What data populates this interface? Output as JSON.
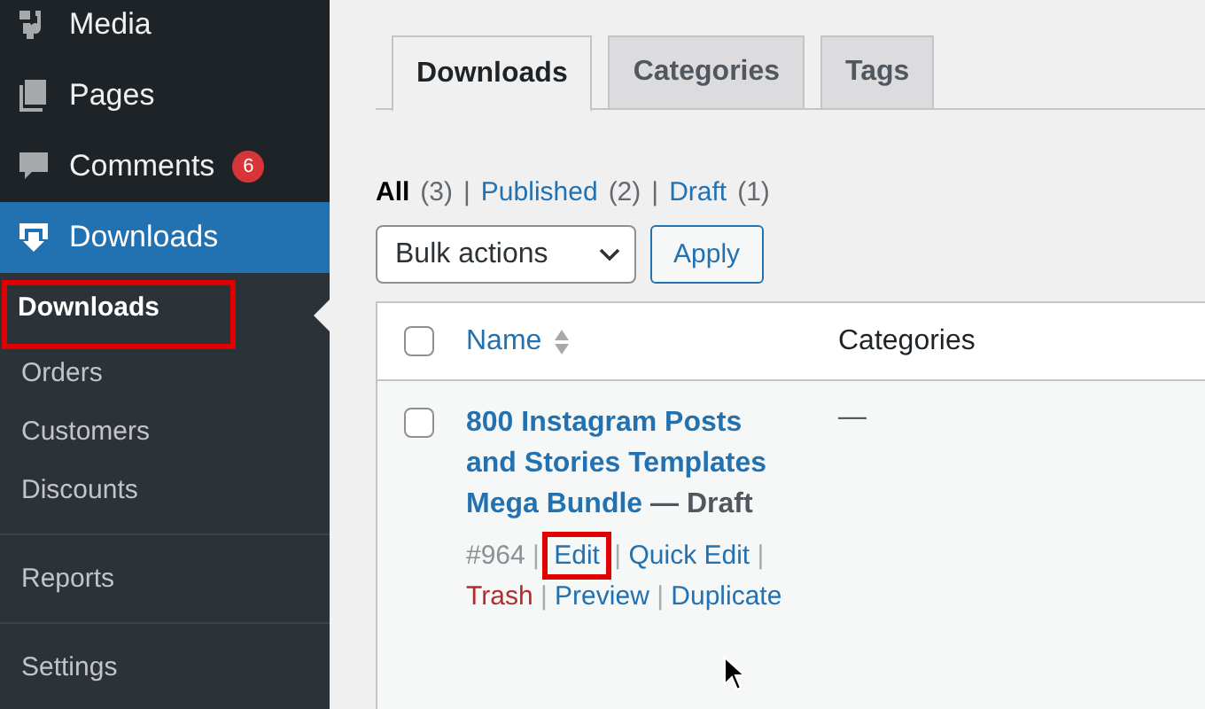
{
  "sidebar": {
    "menu": [
      {
        "kind": "media",
        "label": "Media",
        "current": false
      },
      {
        "kind": "pages",
        "label": "Pages",
        "current": false
      },
      {
        "kind": "comments",
        "label": "Comments",
        "current": false,
        "badge": "6"
      },
      {
        "kind": "downloads",
        "label": "Downloads",
        "current": true
      }
    ],
    "groups": [
      {
        "items": [
          {
            "label": "Downloads",
            "selected": true,
            "highlighted": true
          },
          {
            "label": "Orders",
            "selected": false,
            "highlighted": false
          },
          {
            "label": "Customers",
            "selected": false,
            "highlighted": false
          },
          {
            "label": "Discounts",
            "selected": false,
            "highlighted": false
          }
        ]
      },
      {
        "items": [
          {
            "label": "Reports",
            "selected": false,
            "highlighted": false
          }
        ]
      },
      {
        "items": [
          {
            "label": "Settings",
            "selected": false,
            "highlighted": false
          }
        ]
      }
    ]
  },
  "tabs": [
    {
      "label": "Downloads",
      "selected": true
    },
    {
      "label": "Categories",
      "selected": false
    },
    {
      "label": "Tags",
      "selected": false
    }
  ],
  "views": {
    "separator": "|",
    "items": [
      {
        "label": "All",
        "count": "(3)",
        "selected": true
      },
      {
        "label": "Published",
        "count": "(2)",
        "selected": false
      },
      {
        "label": "Draft",
        "count": "(1)",
        "selected": false
      }
    ]
  },
  "bulk_actions": {
    "value": "Bulk actions",
    "button": "Apply"
  },
  "table": {
    "select_all_checked": false,
    "columns": [
      {
        "label": "Name",
        "sortable": true
      },
      {
        "label": "Categories",
        "sortable": false
      }
    ],
    "rows": [
      {
        "checked": false,
        "title": "800 Instagram Posts and Stories Templates Mega Bundle",
        "status": "— Draft",
        "categories": "—",
        "separator": "|",
        "actions": [
          {
            "kind": "id",
            "label": "#964",
            "highlighted": false
          },
          {
            "kind": "link",
            "label": "Edit",
            "highlighted": true
          },
          {
            "kind": "link",
            "label": "Quick Edit",
            "highlighted": false
          },
          {
            "kind": "delete",
            "label": "Trash",
            "highlighted": false
          },
          {
            "kind": "link",
            "label": "Preview",
            "highlighted": false
          },
          {
            "kind": "link",
            "label": "Duplicate",
            "highlighted": false
          }
        ]
      }
    ]
  }
}
